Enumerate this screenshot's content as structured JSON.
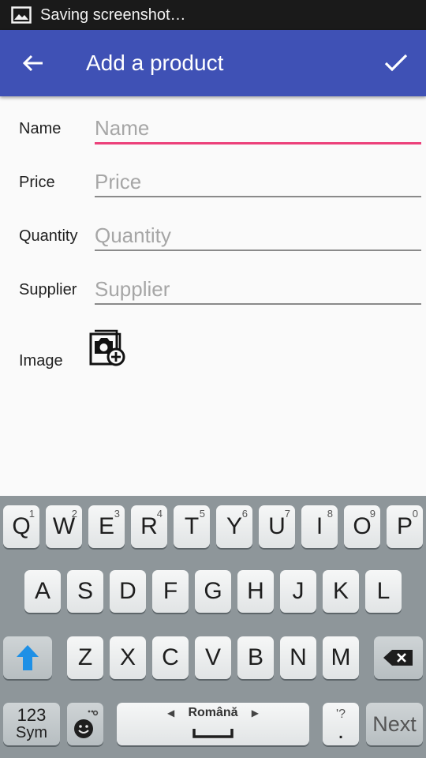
{
  "status_bar": {
    "icon": "image-icon",
    "text": "Saving screenshot…"
  },
  "app_bar": {
    "title": "Add a product",
    "back_icon": "arrow-back-icon",
    "save_icon": "checkmark-icon",
    "color": "#3f51b5"
  },
  "form": {
    "fields": [
      {
        "label": "Name",
        "placeholder": "Name",
        "value": ""
      },
      {
        "label": "Price",
        "placeholder": "Price",
        "value": ""
      },
      {
        "label": "Quantity",
        "placeholder": "Quantity",
        "value": ""
      },
      {
        "label": "Supplier",
        "placeholder": "Supplier",
        "value": ""
      }
    ],
    "image_label": "Image",
    "image_icon": "add-photo-icon",
    "focus_color": "#ec407a"
  },
  "keyboard": {
    "row1": [
      {
        "key": "Q",
        "hint": "1"
      },
      {
        "key": "W",
        "hint": "2"
      },
      {
        "key": "E",
        "hint": "3"
      },
      {
        "key": "R",
        "hint": "4"
      },
      {
        "key": "T",
        "hint": "5"
      },
      {
        "key": "Y",
        "hint": "6"
      },
      {
        "key": "U",
        "hint": "7"
      },
      {
        "key": "I",
        "hint": "8"
      },
      {
        "key": "O",
        "hint": "9"
      },
      {
        "key": "P",
        "hint": "0"
      }
    ],
    "row2": [
      "A",
      "S",
      "D",
      "F",
      "G",
      "H",
      "J",
      "K",
      "L"
    ],
    "row3": [
      "Z",
      "X",
      "C",
      "V",
      "B",
      "N",
      "M"
    ],
    "sym_top": "123",
    "sym_bottom": "Sym",
    "space_label": "Română",
    "punct_top": "'?",
    "punct_bottom": ".",
    "next_label": "Next"
  }
}
